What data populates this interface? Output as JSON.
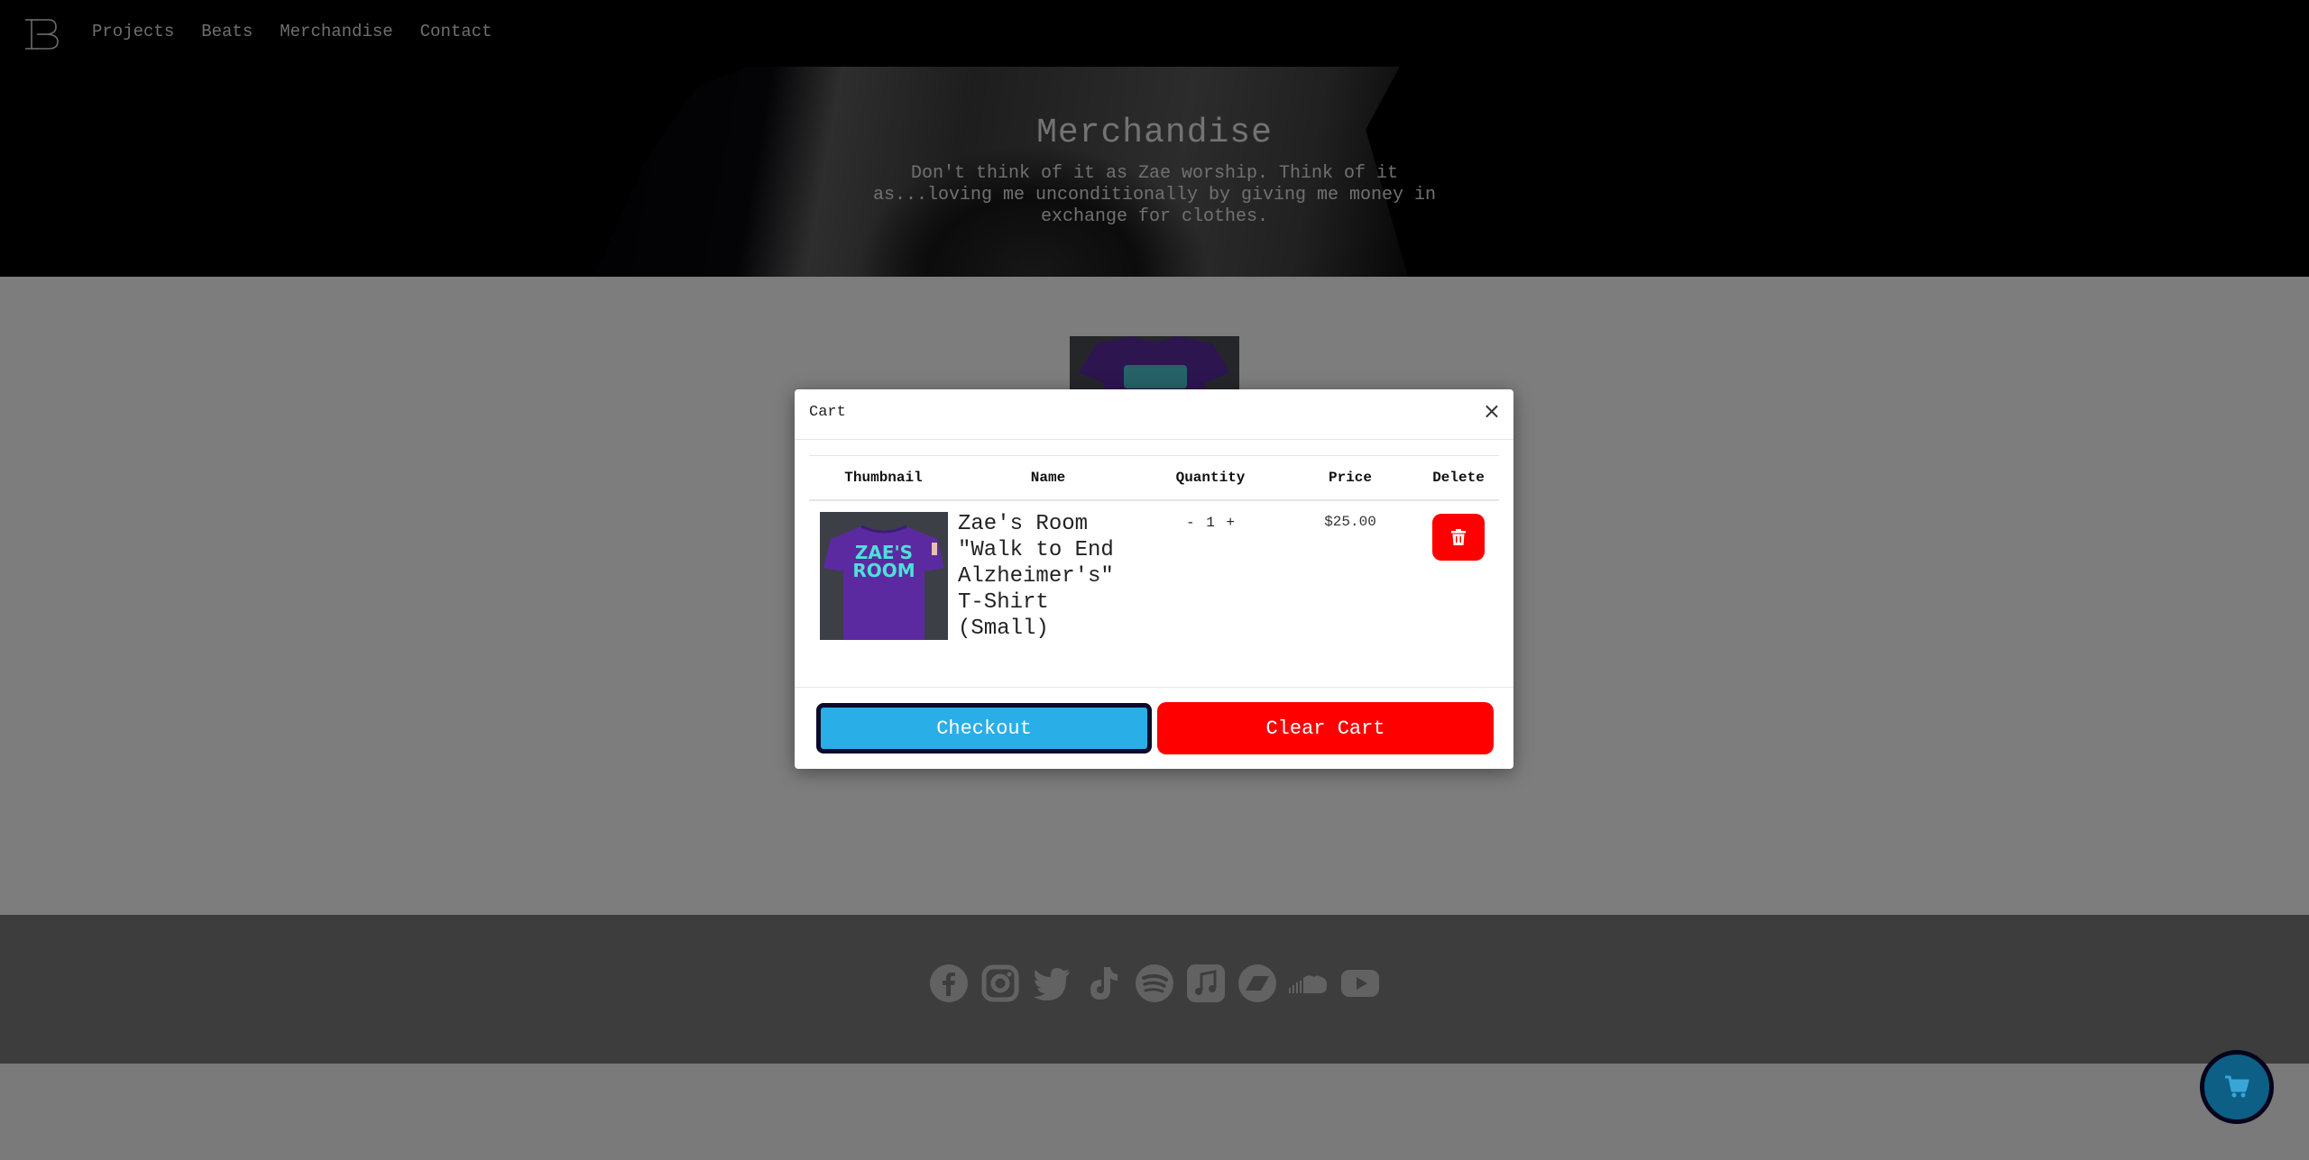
{
  "nav": {
    "logo": "IB",
    "links": [
      "Projects",
      "Beats",
      "Merchandise",
      "Contact"
    ]
  },
  "hero": {
    "title": "Merchandise",
    "subtitle": "Don't think of it as Zae worship. Think of it as...loving me unconditionally by giving me money in exchange for clothes."
  },
  "product": {
    "shirt_text": "ZAE'S ROOM"
  },
  "social_icons": [
    "facebook-icon",
    "instagram-icon",
    "twitter-icon",
    "tiktok-icon",
    "spotify-icon",
    "apple-music-icon",
    "bandcamp-icon",
    "soundcloud-icon",
    "youtube-icon"
  ],
  "cart_modal": {
    "title": "Cart",
    "close_label": "×",
    "columns": [
      "Thumbnail",
      "Name",
      "Quantity",
      "Price",
      "Delete"
    ],
    "items": [
      {
        "name": "Zae's Room \"Walk to End Alzheimer's\" T-Shirt (Small)",
        "quantity": "1",
        "decrement": "-",
        "increment": "+",
        "price": "$25.00"
      }
    ],
    "checkout_label": "Checkout",
    "clear_label": "Clear Cart"
  },
  "colors": {
    "checkout": "#29aee8",
    "danger": "#ff0000",
    "cart_fab": "#0d5f86",
    "shirt": "#5b2aa0",
    "shirt_print": "#4ee0d8"
  }
}
